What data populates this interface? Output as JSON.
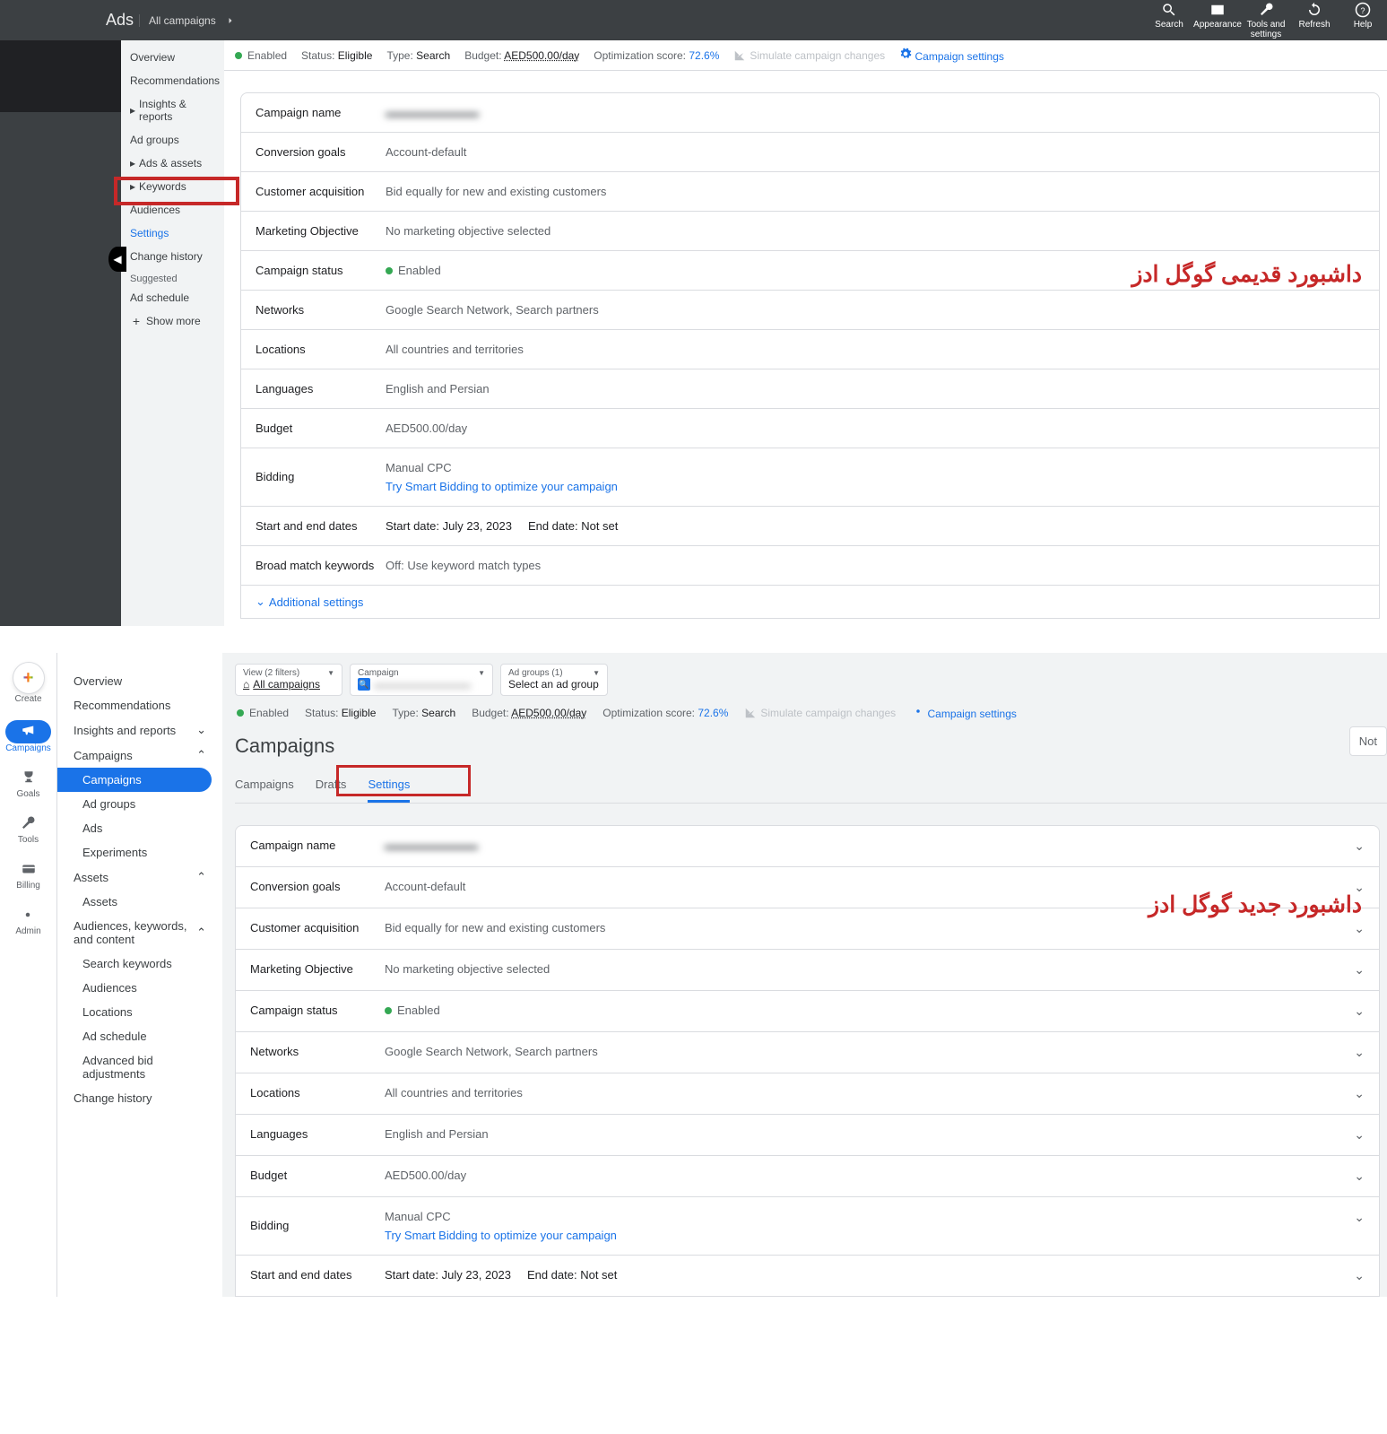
{
  "old": {
    "logo": "Ads",
    "campsel": "All campaigns",
    "actions": [
      "Search",
      "Appearance",
      "Tools and settings",
      "Refresh",
      "Help"
    ],
    "statusbar": {
      "enabled": "Enabled",
      "status_lbl": "Status:",
      "status_val": "Eligible",
      "type_lbl": "Type:",
      "type_val": "Search",
      "budget_lbl": "Budget:",
      "budget_val": "AED500.00/day",
      "opt_lbl": "Optimization score:",
      "opt_val": "72.6%",
      "simulate": "Simulate campaign changes",
      "settings": "Campaign settings"
    },
    "side": {
      "overview": "Overview",
      "recommendations": "Recommendations",
      "insights": "Insights & reports",
      "adgroups": "Ad groups",
      "adsassets": "Ads & assets",
      "keywords": "Keywords",
      "audiences": "Audiences",
      "settings": "Settings",
      "change": "Change history",
      "suggested": "Suggested",
      "adschedule": "Ad schedule",
      "showmore": "Show more"
    },
    "rows": {
      "name_k": "Campaign name",
      "name_v": "",
      "goals_k": "Conversion goals",
      "goals_v": "Account-default",
      "acq_k": "Customer acquisition",
      "acq_v": "Bid equally for new and existing customers",
      "mo_k": "Marketing Objective",
      "mo_v": "No marketing objective selected",
      "status_k": "Campaign status",
      "status_v": "Enabled",
      "net_k": "Networks",
      "net_v": "Google Search Network, Search partners",
      "loc_k": "Locations",
      "loc_v": "All countries and territories",
      "lang_k": "Languages",
      "lang_v": "English and Persian",
      "budget_k": "Budget",
      "budget_v": "AED500.00/day",
      "bid_k": "Bidding",
      "bid_v1": "Manual CPC",
      "bid_v2": "Try Smart Bidding to optimize your campaign",
      "dates_k": "Start and end dates",
      "dates_v1": "Start date: July 23, 2023",
      "dates_v2": "End date: Not set",
      "broad_k": "Broad match keywords",
      "broad_v": "Off: Use keyword match types",
      "addl": "Additional settings"
    },
    "annot": "داشبورد قدیمی گوگل ادز"
  },
  "new": {
    "rail": {
      "create": "Create",
      "campaigns": "Campaigns",
      "goals": "Goals",
      "tools": "Tools",
      "billing": "Billing",
      "admin": "Admin"
    },
    "side": {
      "overview": "Overview",
      "recommendations": "Recommendations",
      "insights": "Insights and reports",
      "campaigns": "Campaigns",
      "campaigns_sub": "Campaigns",
      "adgroups": "Ad groups",
      "ads": "Ads",
      "experiments": "Experiments",
      "assets": "Assets",
      "assets_sub": "Assets",
      "akc": "Audiences, keywords, and content",
      "sk": "Search keywords",
      "aud": "Audiences",
      "loc": "Locations",
      "adsched": "Ad schedule",
      "advbid": "Advanced bid adjustments",
      "change": "Change history"
    },
    "filters": {
      "f1_top": "View (2 filters)",
      "f1_bot": "All campaigns",
      "f2_top": "Campaign",
      "f2_bot": "",
      "f3_top": "Ad groups (1)",
      "f3_bot": "Select an ad group"
    },
    "statusbar": {
      "enabled": "Enabled",
      "status_lbl": "Status:",
      "status_val": "Eligible",
      "type_lbl": "Type:",
      "type_val": "Search",
      "budget_lbl": "Budget:",
      "budget_val": "AED500.00/day",
      "opt_lbl": "Optimization score:",
      "opt_val": "72.6%",
      "simulate": "Simulate campaign changes",
      "settings": "Campaign settings"
    },
    "h1": "Campaigns",
    "tabs": {
      "campaigns": "Campaigns",
      "drafts": "Drafts",
      "settings": "Settings"
    },
    "not": "Not",
    "rows": {
      "name_k": "Campaign name",
      "name_v": "",
      "goals_k": "Conversion goals",
      "goals_v": "Account-default",
      "acq_k": "Customer acquisition",
      "acq_v": "Bid equally for new and existing customers",
      "mo_k": "Marketing Objective",
      "mo_v": "No marketing objective selected",
      "status_k": "Campaign status",
      "status_v": "Enabled",
      "net_k": "Networks",
      "net_v": "Google Search Network, Search partners",
      "loc_k": "Locations",
      "loc_v": "All countries and territories",
      "lang_k": "Languages",
      "lang_v": "English and Persian",
      "budget_k": "Budget",
      "budget_v": "AED500.00/day",
      "bid_k": "Bidding",
      "bid_v1": "Manual CPC",
      "bid_v2": "Try Smart Bidding to optimize your campaign",
      "dates_k": "Start and end dates",
      "dates_v1": "Start date: July 23, 2023",
      "dates_v2": "End date: Not set"
    },
    "annot": "داشبورد جدید گوگل ادز"
  }
}
